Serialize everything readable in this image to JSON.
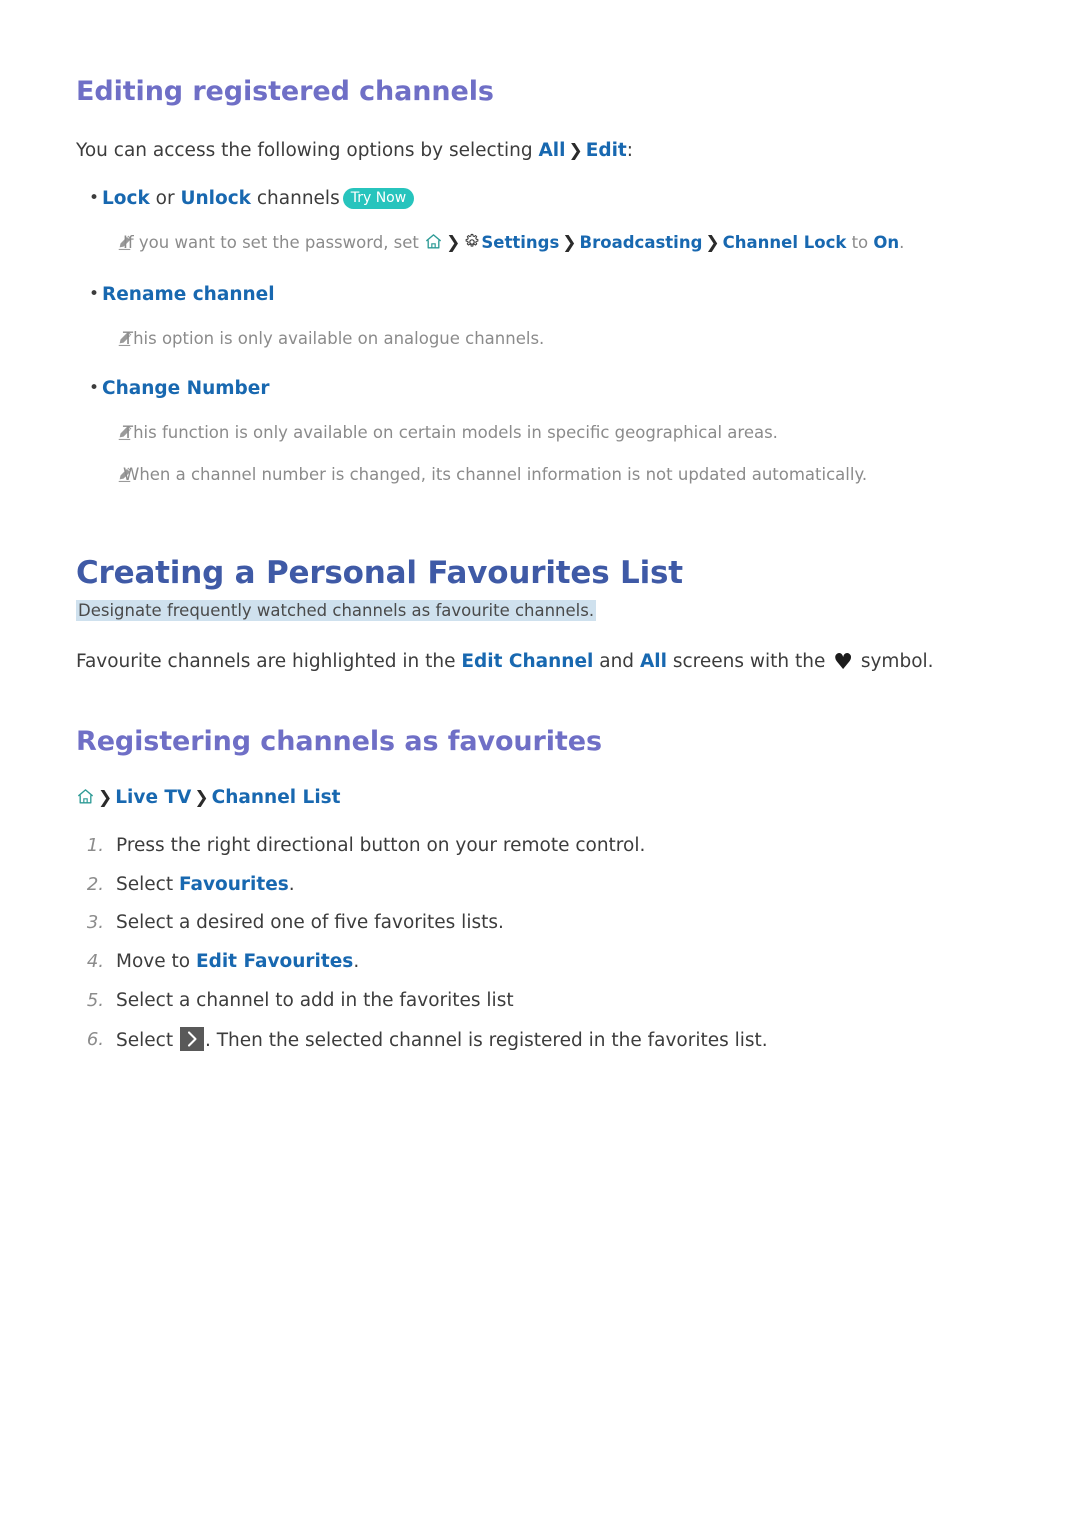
{
  "sections": [
    {
      "id": "editing-registered-channels",
      "heading": "Editing registered channels",
      "intro_pre": "You can access the following options by selecting ",
      "intro_link1": "All",
      "intro_sep": "❯",
      "intro_link2": "Edit",
      "intro_post": ":"
    }
  ],
  "bullets": [
    {
      "dot": "•",
      "link_a": "Lock",
      "mid": " or ",
      "link_b": "Unlock",
      "tail": " channels",
      "badge": "Try Now"
    },
    {
      "dot": "•",
      "label": "Rename channel"
    },
    {
      "dot": "•",
      "label": "Change Number"
    }
  ],
  "notes": {
    "password": {
      "pre": "If you want to set the password, set ",
      "home_icon": "home-icon",
      "sep": "❯",
      "gear_icon": "gear-icon",
      "settings": "Settings",
      "broadcasting": "Broadcasting",
      "channel_lock": "Channel Lock",
      "to": " to ",
      "on": "On",
      "period": "."
    },
    "analogue": "This option is only available on analogue channels.",
    "certain_models": "This function is only available on certain models in specific geographical areas.",
    "channel_number": "When a channel number is changed, its channel information is not updated automatically."
  },
  "favourites": {
    "title": "Creating a Personal Favourites List",
    "subtitle": "Designate frequently watched channels as favourite channels.",
    "para_pre": "Favourite channels are highlighted in the ",
    "para_link1": "Edit Channel",
    "para_mid": " and ",
    "para_link2": "All",
    "para_mid2": " screens with the ",
    "heart_glyph": "♥",
    "para_post": " symbol."
  },
  "registering": {
    "heading": "Registering channels as favourites",
    "breadcrumb": {
      "home_icon": "home-icon",
      "sep": "❯",
      "item1": "Live TV",
      "item2": "Channel List"
    },
    "steps": [
      {
        "num": "1.",
        "pre": "Press the right directional button on your remote control.",
        "link": "",
        "post": ""
      },
      {
        "num": "2.",
        "pre": "Select ",
        "link": "Favourites",
        "post": "."
      },
      {
        "num": "3.",
        "pre": "Select a desired one of five favorites lists.",
        "link": "",
        "post": ""
      },
      {
        "num": "4.",
        "pre": "Move to ",
        "link": "Edit Favourites",
        "post": "."
      },
      {
        "num": "5.",
        "pre": "Select a channel to add in the favorites list",
        "link": "",
        "post": ""
      },
      {
        "num": "6.",
        "pre": "Select ",
        "key_icon": "chevron-right-key-icon",
        "post": ". Then the selected channel is registered in the favorites list."
      }
    ]
  },
  "colors": {
    "heading_h2": "#6f6fc6",
    "heading_h1": "#3f5aa6",
    "link_blue": "#1868b0",
    "badge_teal": "#27c4bd",
    "highlight_blue": "#cfe1ee",
    "note_gray": "#8b8b8b",
    "key_btn_gray": "#595959",
    "body_text": "#3c3c3c"
  }
}
